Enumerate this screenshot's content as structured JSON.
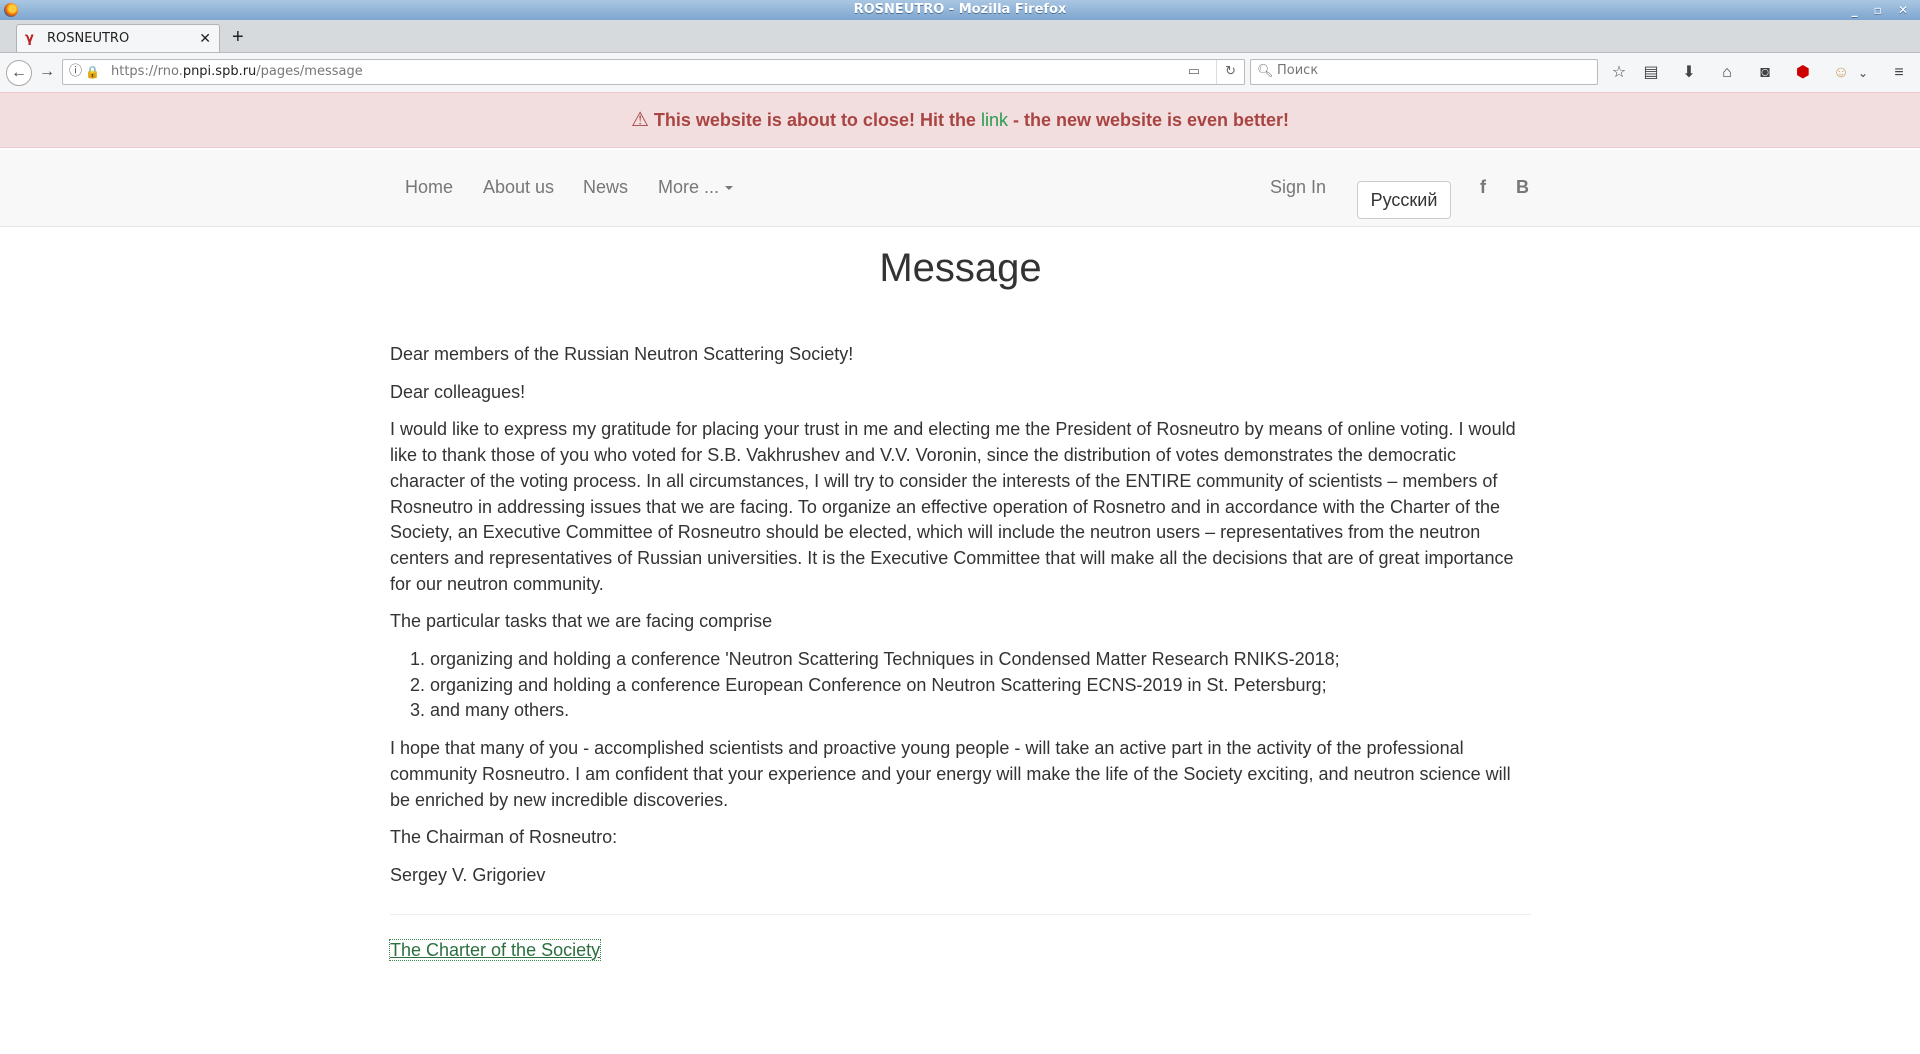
{
  "browser": {
    "window_title": "ROSNEUTRO - Mozilla Firefox",
    "tab_title": "ROSNEUTRO",
    "url_prefix": "https://rno.",
    "url_domain": "pnpi.spb.ru",
    "url_path": "/pages/message",
    "search_placeholder": "Поиск"
  },
  "alert": {
    "before": "This website is about to close! Hit the ",
    "link": "link",
    "after": " - the new website is even better!"
  },
  "nav": {
    "home": "Home",
    "about": "About us",
    "news": "News",
    "more": "More ...",
    "signin": "Sign In",
    "language": "Русский",
    "facebook": "f",
    "vk": "B"
  },
  "page": {
    "title": "Message",
    "greeting1": "Dear members of the Russian Neutron Scattering Society!",
    "greeting2": "Dear colleagues!",
    "paragraph1": "I would like to express my gratitude for placing your trust in me and electing me the President of Rosneutro by means of online voting. I would like to thank those of you who voted for S.B. Vakhrushev and V.V. Voronin, since the distribution of votes demonstrates the democratic character of the voting process. In all circumstances, I will try to consider the interests of the ENTIRE community of scientists – members of Rosneutro in addressing issues that we are facing. To organize an effective operation of Rosnetro and in accordance with the Charter of the Society, an Executive Committee of Rosneutro should be elected, which will include the neutron users – representatives from the neutron centers and representatives of Russian universities. It is the Executive Committee that will make all the decisions that are of great importance for our neutron community.",
    "tasks_intro": "The particular tasks that we are facing comprise",
    "tasks": [
      "organizing and holding a conference 'Neutron Scattering Techniques in Condensed Matter Research RNIKS-2018;",
      "organizing and holding a conference European Conference on Neutron Scattering ECNS-2019 in St. Petersburg;",
      "and many others."
    ],
    "paragraph2": "I hope that many of you - accomplished scientists and proactive young people - will take an active part in the activity of the professional community Rosneutro. I am confident that your experience and your energy will make the life of the Society exciting, and neutron science will be enriched by new incredible discoveries.",
    "signature_role": "The Chairman of Rosneutro:",
    "signature_name": "Sergey V. Grigoriev",
    "charter_link": "The Charter of the Society"
  }
}
